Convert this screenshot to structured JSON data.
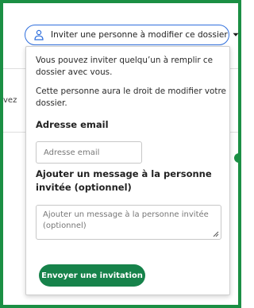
{
  "invite_toggle": {
    "label": "Inviter une personne à modifier ce dossier",
    "icon": "user-icon",
    "caret_icon": "caret-down-icon"
  },
  "background": {
    "left_clipped_text": "vez"
  },
  "popover": {
    "intro": "Vous pouvez inviter quelqu’un à remplir ce dossier avec vous.",
    "rights": "Cette personne aura le droit de modifier votre dossier.",
    "email": {
      "label": "Adresse email",
      "placeholder": "Adresse email"
    },
    "message": {
      "label": "Ajouter un message à la personne invitée (optionnel)",
      "placeholder": "Ajouter un message à la personne invitée (optionnel)"
    },
    "submit_label": "Envoyer une invitation"
  },
  "colors": {
    "frame_green": "#1b8f44",
    "button_green": "#16824a",
    "focus_blue": "#2f6fdd"
  }
}
